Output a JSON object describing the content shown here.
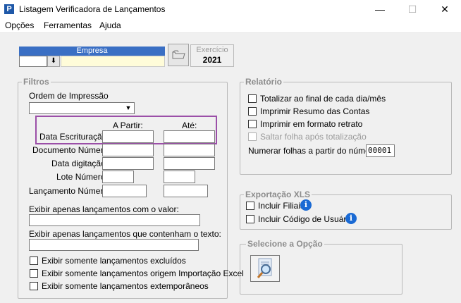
{
  "window": {
    "title": "Listagem Verificadora de Lançamentos",
    "app_icon": "P",
    "minimize": "—",
    "maximize": "☐",
    "close": "✕"
  },
  "menu": {
    "items": [
      {
        "label": "Opções"
      },
      {
        "label": "Ferramentas"
      },
      {
        "label": "Ajuda"
      }
    ]
  },
  "empresa": {
    "label": "Empresa",
    "code_value": "",
    "name_value": "",
    "dropdown_icon": "arrow-down-line-icon",
    "folder_icon": "open-folder-icon"
  },
  "exercicio": {
    "label": "Exercício",
    "value": "2021"
  },
  "filtros": {
    "title": "Filtros",
    "ordem_label": "Ordem de Impressão",
    "ordem_value": "",
    "a_partir": "A Partir:",
    "ate": "Até:",
    "rows": [
      {
        "label": "Data Escrituração"
      },
      {
        "label": "Documento Número"
      },
      {
        "label": "Data digitação"
      },
      {
        "label": "Lote Número"
      },
      {
        "label": "Lançamento Número"
      }
    ],
    "valor_label": "Exibir apenas lançamentos com o valor:",
    "texto_label": "Exibir apenas lançamentos que contenham o texto:",
    "checks": [
      {
        "label": "Exibir somente lançamentos excluídos"
      },
      {
        "label": "Exibir somente lançamentos origem Importação Excel"
      },
      {
        "label": "Exibir somente lançamentos extemporâneos"
      }
    ]
  },
  "relatorio": {
    "title": "Relatório",
    "checks": [
      {
        "label": "Totalizar ao final de cada dia/mês",
        "disabled": false
      },
      {
        "label": "Imprimir Resumo das Contas",
        "disabled": false
      },
      {
        "label": "Imprimir em formato retrato",
        "disabled": false
      },
      {
        "label": "Saltar folha após totalização",
        "disabled": true
      }
    ],
    "numerar_label": "Numerar folhas a partir do número",
    "numerar_value": "00001"
  },
  "exportacao": {
    "title": "Exportação XLS",
    "checks": [
      {
        "label": "Incluir Filiais"
      },
      {
        "label": "Incluir Código de Usuário"
      }
    ],
    "info_icon": "i"
  },
  "selecione": {
    "title": "Selecione a Opção",
    "button_icon": "magnifier-document-icon"
  },
  "colors": {
    "highlight": "#9b4fa8",
    "empresa_header": "#3a6fc4"
  }
}
